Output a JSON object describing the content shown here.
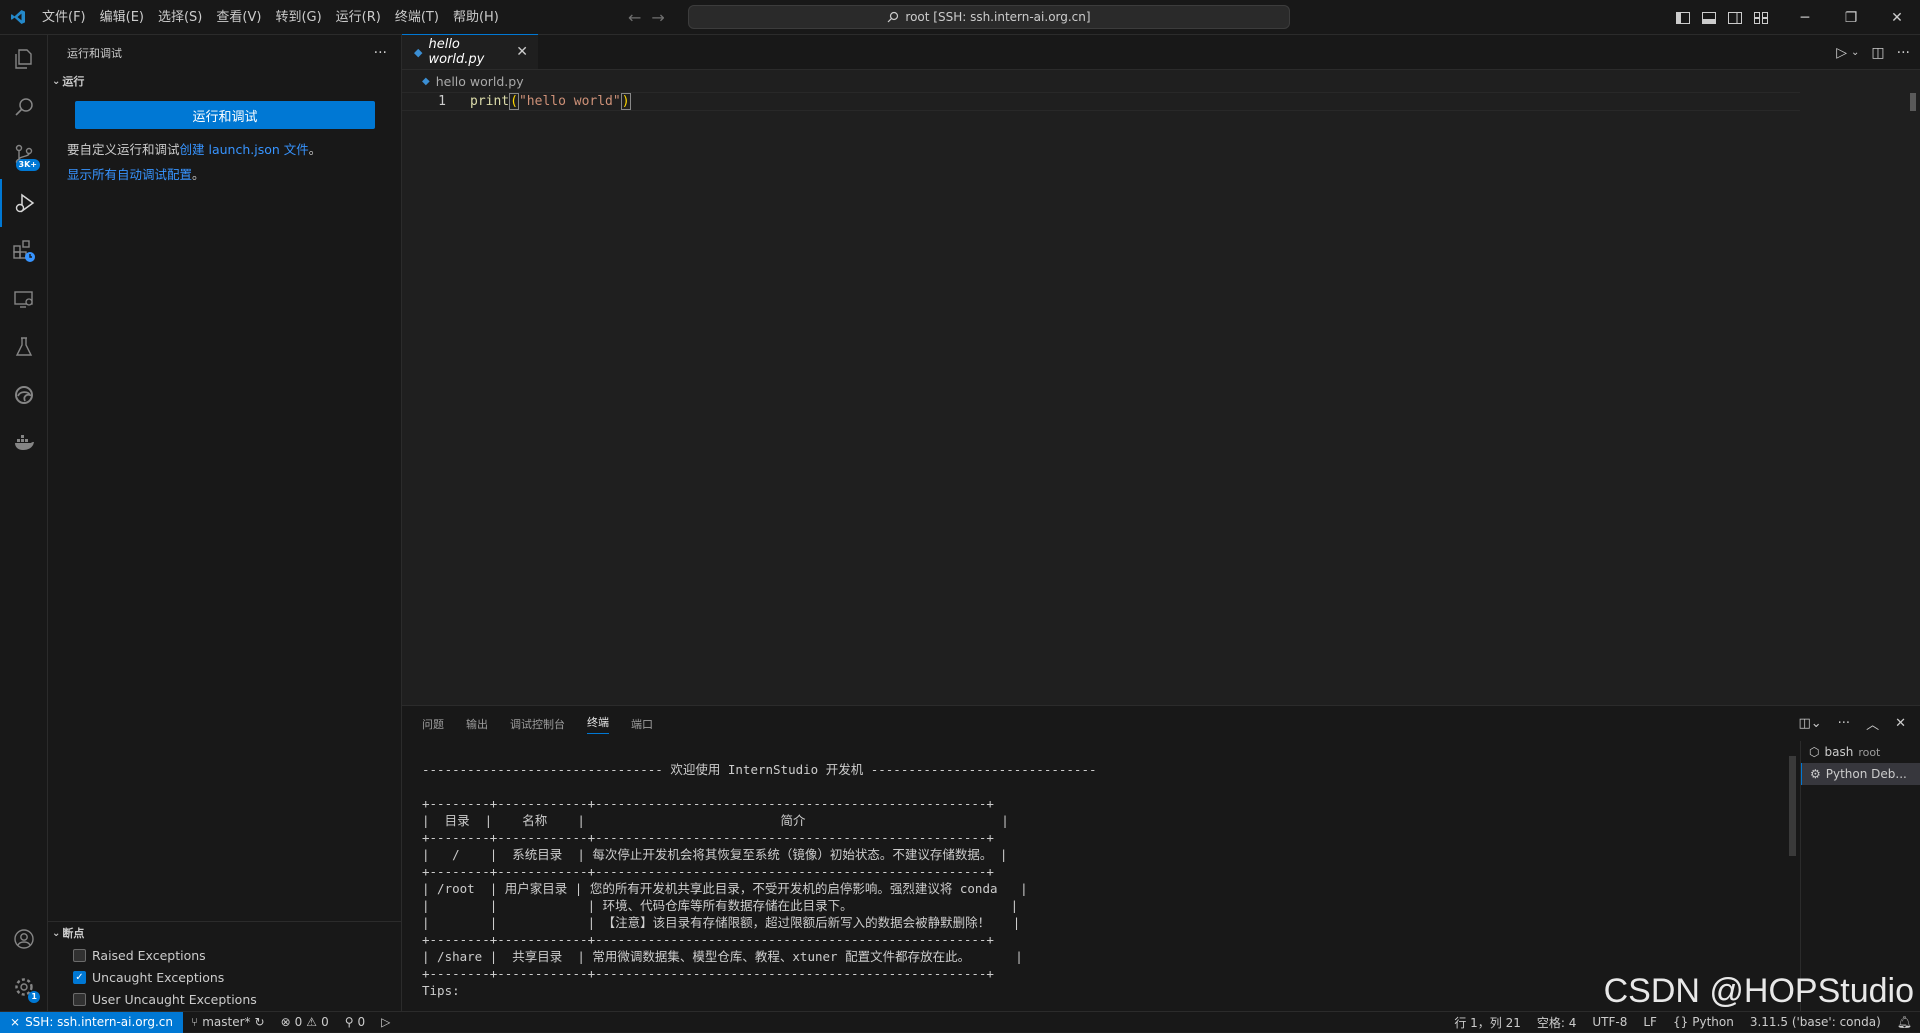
{
  "titlebar": {
    "menu": [
      "文件(F)",
      "编辑(E)",
      "选择(S)",
      "查看(V)",
      "转到(G)",
      "运行(R)",
      "终端(T)",
      "帮助(H)"
    ],
    "command_center": "root [SSH: ssh.intern-ai.org.cn]"
  },
  "activity": {
    "scm_badge": "3K+",
    "settings_badge": "1"
  },
  "sidebar": {
    "title": "运行和调试",
    "section_run": "运行",
    "run_button": "运行和调试",
    "customize_prefix": "要自定义运行和调试",
    "customize_link": "创建 launch.json 文件",
    "customize_suffix": "。",
    "show_all_link": "显示所有自动调试配置",
    "show_all_suffix": "。",
    "breakpoints_title": "断点",
    "breakpoints": [
      {
        "label": "Raised Exceptions",
        "checked": false
      },
      {
        "label": "Uncaught Exceptions",
        "checked": true
      },
      {
        "label": "User Uncaught Exceptions",
        "checked": false
      }
    ]
  },
  "editor": {
    "tab_label": "hello world.py",
    "breadcrumb": "hello world.py",
    "line_number": "1",
    "code_fn": "print",
    "code_str": "\"hello world\""
  },
  "panel": {
    "tabs": [
      "问题",
      "输出",
      "调试控制台",
      "终端",
      "端口"
    ],
    "active_tab": "终端",
    "terminal_text": "-------------------------------- 欢迎使用 InternStudio 开发机 ------------------------------\n\n+--------+------------+----------------------------------------------------+\n|  目录  |    名称    |                          简介                          |\n+--------+------------+----------------------------------------------------+\n|   /    |  系统目录  | 每次停止开发机会将其恢复至系统（镜像）初始状态。不建议存储数据。 |\n+--------+------------+----------------------------------------------------+\n| /root  | 用户家目录 | 您的所有开发机共享此目录，不受开发机的启停影响。强烈建议将 conda   |\n|        |            | 环境、代码仓库等所有数据存储在此目录下。                     |\n|        |            | 【注意】该目录有存储限额，超过限额后新写入的数据会被静默删除！   |\n+--------+------------+----------------------------------------------------+\n| /share |  共享目录  | 常用微调数据集、模型仓库、教程、xtuner 配置文件都存放在此。      |\n+--------+------------+----------------------------------------------------+\nTips:",
    "terminals": [
      {
        "name": "bash",
        "detail": "root"
      },
      {
        "name": "Python Deb...",
        "detail": ""
      }
    ]
  },
  "watermark": "CSDN @HOPStudio",
  "statusbar": {
    "remote": "SSH: ssh.intern-ai.org.cn",
    "branch": "master*",
    "errors": "0",
    "warnings": "0",
    "ports": "0",
    "position": "行 1，列 21",
    "spaces": "空格: 4",
    "encoding": "UTF-8",
    "eol": "LF",
    "language": "Python",
    "interpreter": "3.11.5 ('base': conda)"
  },
  "colors": {
    "accent": "#0078d4",
    "link": "#3794ff",
    "string": "#ce9178",
    "function": "#dcdcaa"
  }
}
